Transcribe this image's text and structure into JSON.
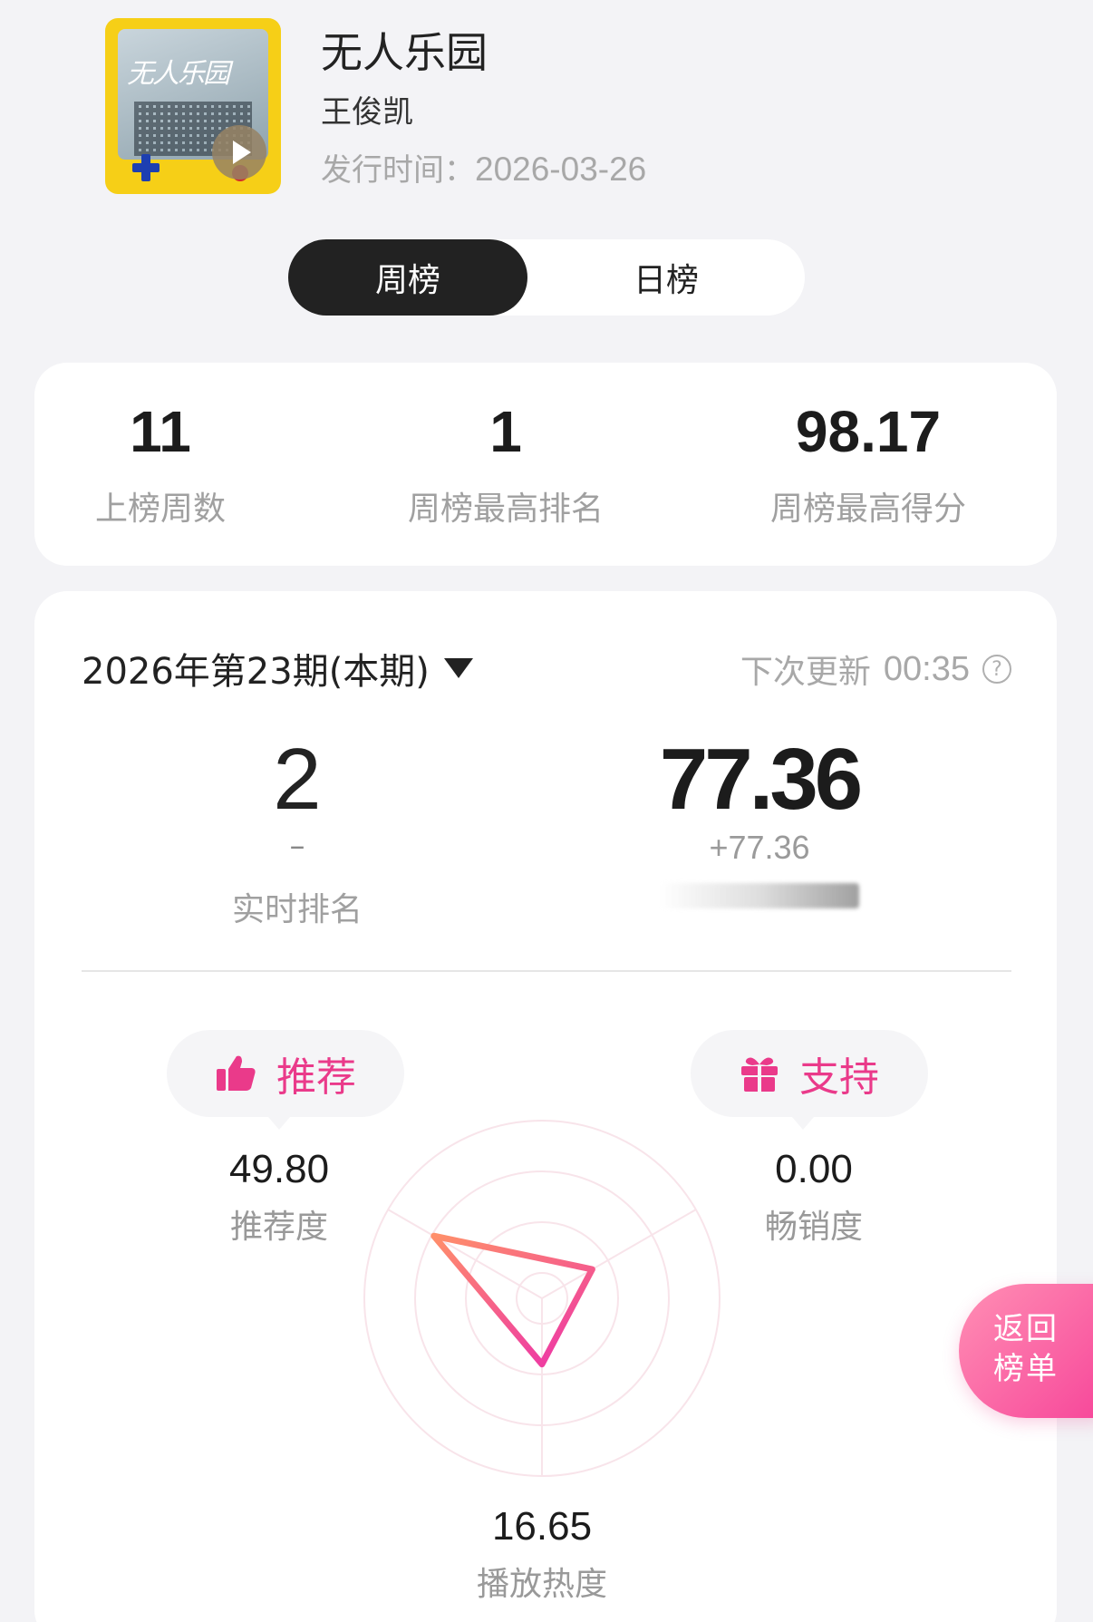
{
  "song": {
    "title": "无人乐园",
    "artist": "王俊凯",
    "release_label": "发行时间：",
    "release_date": "2026-03-26",
    "cover_text": "无人乐园"
  },
  "tabs": [
    {
      "label": "周榜",
      "active": true
    },
    {
      "label": "日榜",
      "active": false
    }
  ],
  "stats": [
    {
      "value": "11",
      "label": "上榜周数"
    },
    {
      "value": "1",
      "label": "周榜最高排名"
    },
    {
      "value": "98.17",
      "label": "周榜最高得分"
    }
  ],
  "period": {
    "label": "2026年第23期(本期)",
    "next_update_label": "下次更新",
    "next_update_time": "00:35"
  },
  "realtime": {
    "rank": "2",
    "rank_change": "–",
    "rank_label": "实时排名",
    "score": "77.36",
    "score_change": "+77.36"
  },
  "radar": {
    "recommend_pill": "推荐",
    "support_pill": "支持",
    "recommend_value": "49.80",
    "recommend_label": "推荐度",
    "sales_value": "0.00",
    "sales_label": "畅销度",
    "play_value": "16.65",
    "play_label": "播放热度",
    "values_fraction": {
      "recommend": 0.498,
      "sales": 0.0,
      "play": 0.1665
    },
    "accent_gradient": [
      "#ff8f6a",
      "#ef3fa0"
    ]
  },
  "back_button": {
    "line1": "返回",
    "line2": "榜单"
  },
  "colors": {
    "accent": "#ea3a8a",
    "dark": "#222222",
    "bg": "#f3f3f6"
  }
}
